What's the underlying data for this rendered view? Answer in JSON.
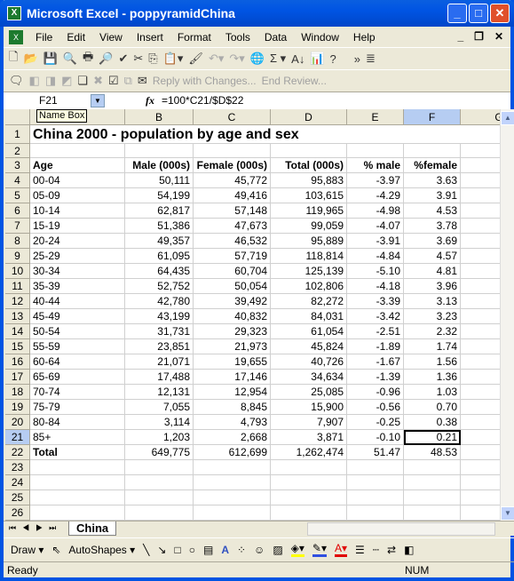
{
  "window": {
    "title": "Microsoft Excel - poppyramidChina",
    "minimize": "_",
    "maximize": "□",
    "close": "✕"
  },
  "menu": {
    "items": [
      "File",
      "Edit",
      "View",
      "Insert",
      "Format",
      "Tools",
      "Data",
      "Window",
      "Help"
    ],
    "doc_min": "_",
    "doc_restore": "❐",
    "doc_close": "✕"
  },
  "toolbar": {
    "icons": [
      "new-icon",
      "open-icon",
      "save-icon",
      "permission-icon",
      "print-icon",
      "print-preview-icon",
      "spelling-icon",
      "cut-icon",
      "copy-icon",
      "paste-icon",
      "format-painter-icon",
      "undo-icon",
      "redo-icon",
      "hyperlink-icon",
      "autosum-icon",
      "sort-ascending-icon",
      "chart-wizard-icon",
      "help-icon",
      "overflow-icon",
      "align-icon"
    ],
    "reply_with_changes": "Reply with Changes...",
    "end_review": "End Review..."
  },
  "formula_bar": {
    "name_box": "F21",
    "fx": "fx",
    "formula": "=100*C21/$D$22",
    "tooltip": "Name Box"
  },
  "columns": [
    "A",
    "B",
    "C",
    "D",
    "E",
    "F",
    "G"
  ],
  "sheet": {
    "title": "China 2000 - population by age and sex",
    "headers": [
      "Age",
      "Male (000s)",
      "Female (000s)",
      "Total (000s)",
      "% male",
      "%female"
    ],
    "rows": [
      [
        "00-04",
        "50,111",
        "45,772",
        "95,883",
        "-3.97",
        "3.63"
      ],
      [
        "05-09",
        "54,199",
        "49,416",
        "103,615",
        "-4.29",
        "3.91"
      ],
      [
        "10-14",
        "62,817",
        "57,148",
        "119,965",
        "-4.98",
        "4.53"
      ],
      [
        "15-19",
        "51,386",
        "47,673",
        "99,059",
        "-4.07",
        "3.78"
      ],
      [
        "20-24",
        "49,357",
        "46,532",
        "95,889",
        "-3.91",
        "3.69"
      ],
      [
        "25-29",
        "61,095",
        "57,719",
        "118,814",
        "-4.84",
        "4.57"
      ],
      [
        "30-34",
        "64,435",
        "60,704",
        "125,139",
        "-5.10",
        "4.81"
      ],
      [
        "35-39",
        "52,752",
        "50,054",
        "102,806",
        "-4.18",
        "3.96"
      ],
      [
        "40-44",
        "42,780",
        "39,492",
        "82,272",
        "-3.39",
        "3.13"
      ],
      [
        "45-49",
        "43,199",
        "40,832",
        "84,031",
        "-3.42",
        "3.23"
      ],
      [
        "50-54",
        "31,731",
        "29,323",
        "61,054",
        "-2.51",
        "2.32"
      ],
      [
        "55-59",
        "23,851",
        "21,973",
        "45,824",
        "-1.89",
        "1.74"
      ],
      [
        "60-64",
        "21,071",
        "19,655",
        "40,726",
        "-1.67",
        "1.56"
      ],
      [
        "65-69",
        "17,488",
        "17,146",
        "34,634",
        "-1.39",
        "1.36"
      ],
      [
        "70-74",
        "12,131",
        "12,954",
        "25,085",
        "-0.96",
        "1.03"
      ],
      [
        "75-79",
        "7,055",
        "8,845",
        "15,900",
        "-0.56",
        "0.70"
      ],
      [
        "80-84",
        "3,114",
        "4,793",
        "7,907",
        "-0.25",
        "0.38"
      ],
      [
        "85+",
        "1,203",
        "2,668",
        "3,871",
        "-0.10",
        "0.21"
      ]
    ],
    "total": [
      "Total",
      "649,775",
      "612,699",
      "1,262,474",
      "51.47",
      "48.53"
    ],
    "active_cell": "F21"
  },
  "tabs": {
    "sheet": "China"
  },
  "drawing": {
    "draw": "Draw ▾",
    "autoshapes": "AutoShapes ▾"
  },
  "status": {
    "text": "Ready",
    "num": "NUM"
  }
}
